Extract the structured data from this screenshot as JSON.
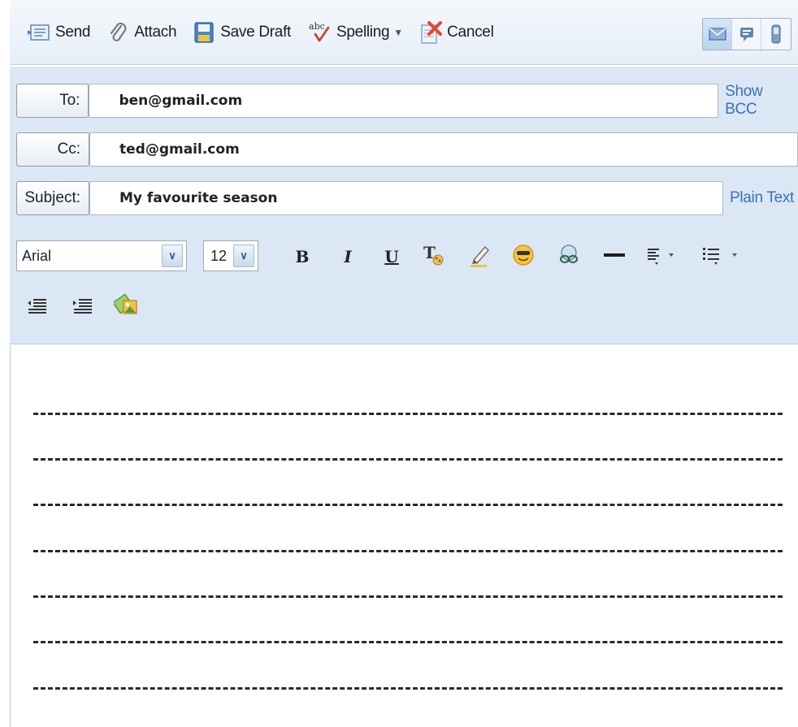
{
  "toolbar": {
    "send_label": "Send",
    "attach_label": "Attach",
    "save_draft_label": "Save Draft",
    "spelling_label": "Spelling",
    "spelling_icon_text": "abc",
    "cancel_label": "Cancel",
    "icons": {
      "send": "send-icon",
      "attach": "paperclip-icon",
      "save_draft": "floppy-disk-icon",
      "spelling": "spellcheck-icon",
      "cancel": "cancel-icon"
    },
    "view_buttons": [
      "envelope-icon",
      "speech-bubble-icon",
      "mobile-phone-icon"
    ]
  },
  "header": {
    "to_label": "To:",
    "to_value": "ben@gmail.com",
    "show_bcc_label": "Show BCC",
    "cc_label": "Cc:",
    "cc_value": "ted@gmail.com",
    "subject_label": "Subject:",
    "subject_value": "My favourite season",
    "plain_text_label": "Plain Text"
  },
  "format_bar": {
    "font": "Arial",
    "size": "12",
    "bold": "B",
    "italic": "I",
    "underline": "U",
    "icons": [
      "text-color-icon",
      "highlighter-icon",
      "emoticon-icon",
      "insert-link-icon",
      "horizontal-rule-icon",
      "align-icon",
      "bullet-list-icon",
      "outdent-icon",
      "indent-icon",
      "insert-image-icon"
    ]
  },
  "colors": {
    "header_bg": "#dbe7f4",
    "link": "#3a72b8",
    "toolbar_bg": "#e6eef7"
  },
  "body": {
    "dashed_lines": 7
  }
}
